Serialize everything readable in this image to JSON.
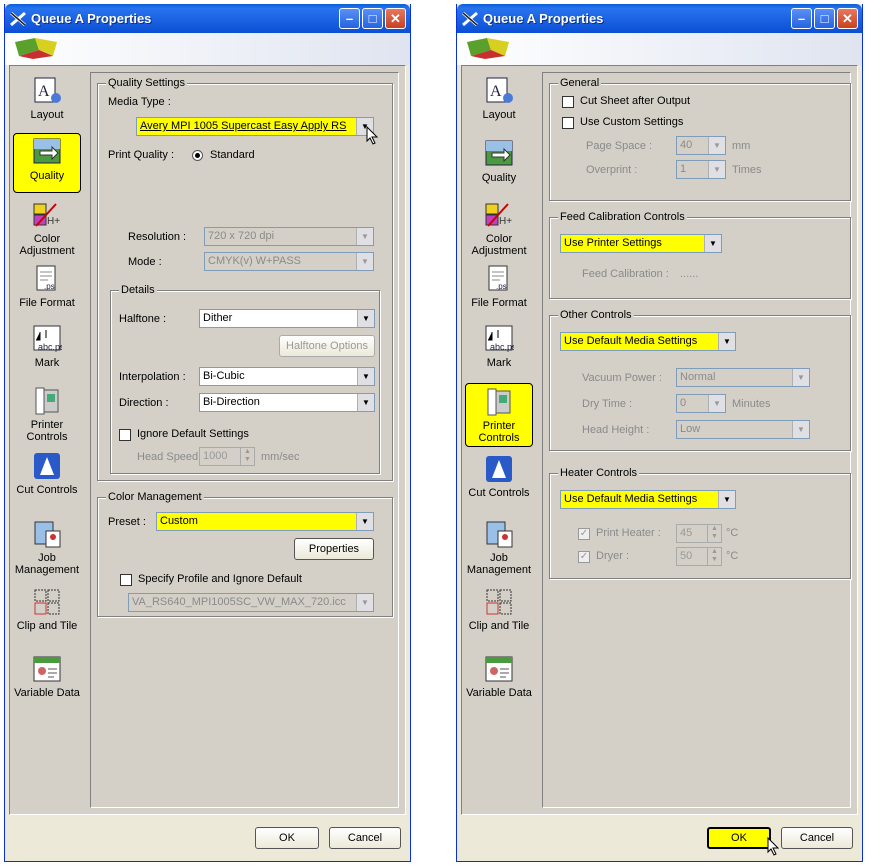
{
  "left": {
    "title": "Queue A Properties",
    "nav": [
      {
        "label": "Layout"
      },
      {
        "label": "Quality"
      },
      {
        "label": "Color Adjustment"
      },
      {
        "label": "File Format"
      },
      {
        "label": "Mark"
      },
      {
        "label": "Printer Controls"
      },
      {
        "label": "Cut Controls"
      },
      {
        "label": "Job Management"
      },
      {
        "label": "Clip and Tile"
      },
      {
        "label": "Variable Data"
      }
    ],
    "quality": {
      "group": "Quality Settings",
      "media_type_label": "Media Type :",
      "media_type": "Avery MPI 1005 Supercast Easy Apply RS",
      "print_quality_label": "Print Quality :",
      "print_quality": "Standard",
      "resolution_label": "Resolution :",
      "resolution": "720 x 720 dpi",
      "mode_label": "Mode :",
      "mode": "CMYK(v) W+PASS"
    },
    "details": {
      "group": "Details",
      "halftone_label": "Halftone :",
      "halftone": "Dither",
      "halftone_options": "Halftone Options",
      "interpolation_label": "Interpolation :",
      "interpolation": "Bi-Cubic",
      "direction_label": "Direction :",
      "direction": "Bi-Direction",
      "ignore_default": "Ignore Default Settings",
      "head_speed_label": "Head Speed",
      "head_speed": "1000",
      "head_speed_unit": "mm/sec"
    },
    "color": {
      "group": "Color Management",
      "preset_label": "Preset :",
      "preset": "Custom",
      "properties": "Properties",
      "specify_profile": "Specify Profile and Ignore Default",
      "profile": "VA_RS640_MPI1005SC_VW_MAX_720.icc"
    },
    "ok": "OK",
    "cancel": "Cancel"
  },
  "right": {
    "title": "Queue A Properties",
    "general": {
      "group": "General",
      "cut_sheet": "Cut Sheet after Output",
      "use_custom": "Use Custom Settings",
      "page_space_label": "Page Space :",
      "page_space": "40",
      "page_space_unit": "mm",
      "overprint_label": "Overprint :",
      "overprint": "1",
      "overprint_unit": "Times"
    },
    "feed": {
      "group": "Feed Calibration Controls",
      "setting": "Use Printer Settings",
      "feed_cal_label": "Feed Calibration :",
      "feed_cal_value": "......"
    },
    "other": {
      "group": "Other Controls",
      "setting": "Use Default Media Settings",
      "vacuum_label": "Vacuum Power :",
      "vacuum": "Normal",
      "dry_label": "Dry Time :",
      "dry": "0",
      "dry_unit": "Minutes",
      "head_height_label": "Head Height :",
      "head_height": "Low"
    },
    "heater": {
      "group": "Heater Controls",
      "setting": "Use Default Media Settings",
      "print_heater_label": "Print Heater :",
      "print_heater": "45",
      "dryer_label": "Dryer :",
      "dryer": "50",
      "unit": "°C"
    },
    "ok": "OK",
    "cancel": "Cancel"
  },
  "colors": {
    "highlight": "#ffff00",
    "titlebar": "#0a5fd8",
    "dialog": "#d4d0c8"
  }
}
